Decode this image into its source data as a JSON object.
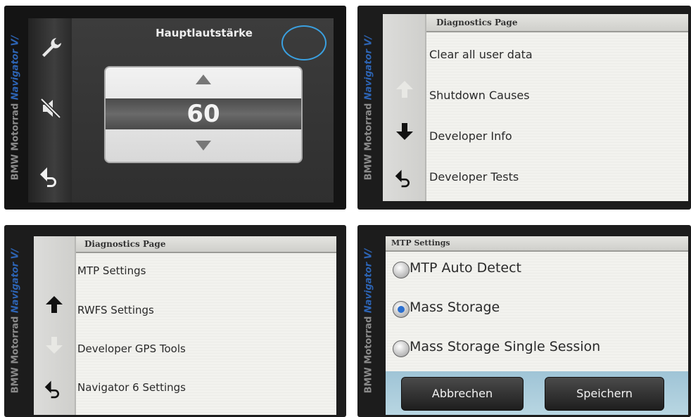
{
  "brand": {
    "bmw": "BMW Motorrad",
    "nav": "Navigator V/"
  },
  "volume": {
    "title": "Hauptlautstärke",
    "value": "60"
  },
  "diag1": {
    "header": "Diagnostics Page",
    "items": [
      "Clear all user data",
      "Shutdown Causes",
      "Developer Info",
      "Developer Tests"
    ]
  },
  "diag2": {
    "header": "Diagnostics Page",
    "items": [
      "MTP Settings",
      "RWFS Settings",
      "Developer GPS Tools",
      "Navigator 6 Settings"
    ]
  },
  "mtp": {
    "header": "MTP Settings",
    "options": [
      {
        "label": "MTP Auto Detect",
        "selected": false
      },
      {
        "label": "Mass Storage",
        "selected": true
      },
      {
        "label": "Mass Storage Single Session",
        "selected": false
      }
    ],
    "cancel": "Abbrechen",
    "save": "Speichern"
  },
  "colors": {
    "accent": "#2d64b4",
    "annotation": "#3aa0e0"
  }
}
